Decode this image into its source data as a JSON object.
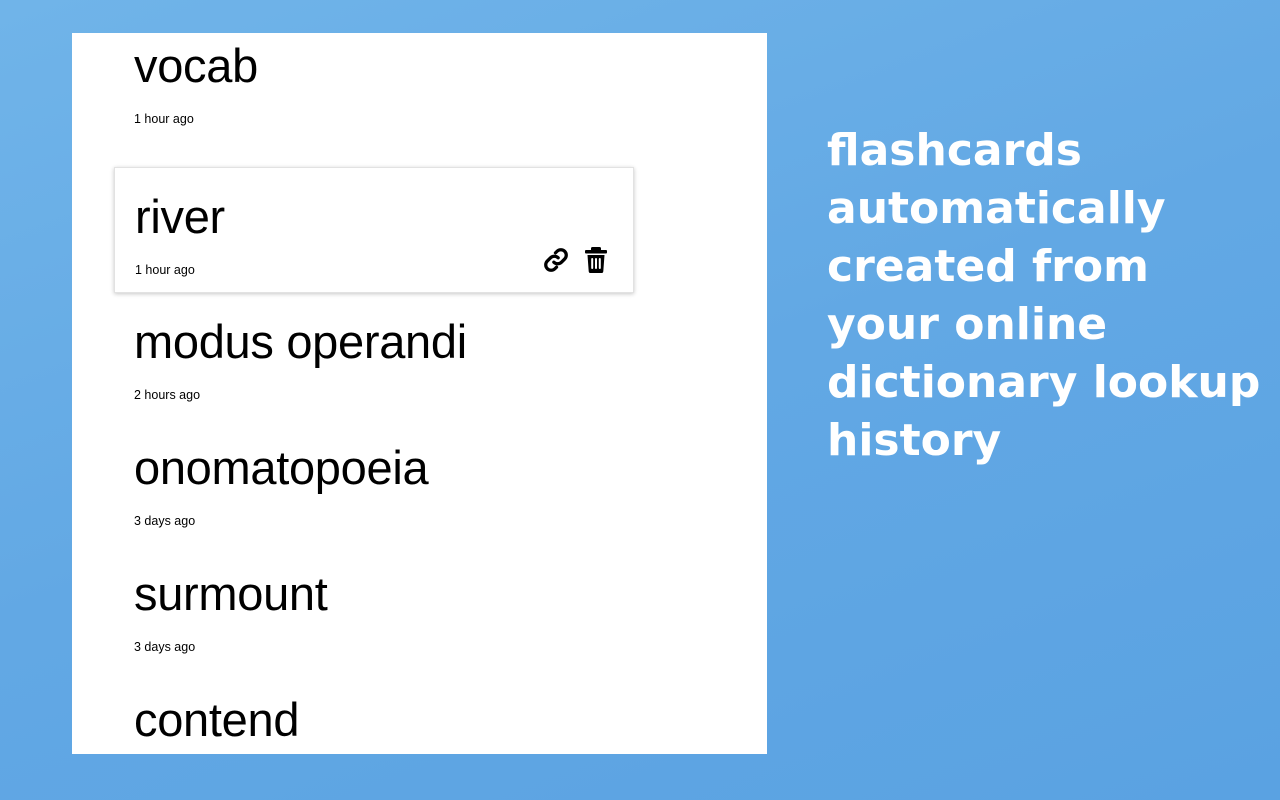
{
  "history": {
    "items": [
      {
        "word": "vocab",
        "time": "1 hour ago"
      },
      {
        "word": "river",
        "time": "1 hour ago"
      },
      {
        "word": "modus operandi",
        "time": "2 hours ago"
      },
      {
        "word": "onomatopoeia",
        "time": "3 days ago"
      },
      {
        "word": "surmount",
        "time": "3 days ago"
      },
      {
        "word": "contend",
        "time": ""
      }
    ],
    "hovered_actions": [
      "link-icon",
      "trash-icon"
    ]
  },
  "promo": {
    "tagline": "flashcards\nautomatically\ncreated  from\nyour online\ndictionary lookup\nhistory"
  },
  "colors": {
    "background": "#62a8e4",
    "panel": "#ffffff",
    "text": "#000000",
    "tagline": "#ffffff"
  }
}
